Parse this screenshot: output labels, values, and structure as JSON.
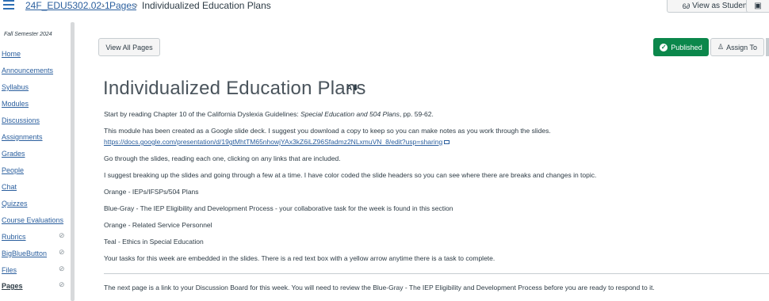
{
  "topbar": {
    "breadcrumbs": [
      "24F_EDU5302.02-1",
      "Pages",
      "Individualized Education Plans"
    ],
    "view_as_student": "View as Student",
    "view_icon": "glasses-icon"
  },
  "sidebar": {
    "term": "Fall Semester 2024",
    "items": [
      {
        "label": "Home",
        "hidden": false
      },
      {
        "label": "Announcements",
        "hidden": false
      },
      {
        "label": "Syllabus",
        "hidden": false
      },
      {
        "label": "Modules",
        "hidden": false
      },
      {
        "label": "Discussions",
        "hidden": false
      },
      {
        "label": "Assignments",
        "hidden": false
      },
      {
        "label": "Grades",
        "hidden": false
      },
      {
        "label": "People",
        "hidden": false
      },
      {
        "label": "Chat",
        "hidden": false
      },
      {
        "label": "Quizzes",
        "hidden": false
      },
      {
        "label": "Course Evaluations",
        "hidden": false
      },
      {
        "label": "Rubrics",
        "hidden": true
      },
      {
        "label": "BigBlueButton",
        "hidden": true
      },
      {
        "label": "Files",
        "hidden": true
      },
      {
        "label": "Pages",
        "hidden": true,
        "active": true
      }
    ]
  },
  "toolbar": {
    "view_all_pages": "View All Pages",
    "published": "Published",
    "assign_to": "Assign To"
  },
  "page": {
    "title": "Individualized Education Plans",
    "p1_pre": "Start by reading Chapter 10 of the California Dyslexia Guidelines: ",
    "p1_em": "Special Education and 504 Plans",
    "p1_post": ", pp. 59-62.",
    "p2": "This module has been created as a Google slide deck. I suggest you download a copy to keep so you can make notes as you work through the slides.",
    "link": "https://docs.google.com/presentation/d/19gtMhtTM65nhowjYAx3kZ6iLZ96Sfadmz2NLxmuVN_8/edit?usp=sharing",
    "p3": "Go through the slides, reading each one, clicking on any links that are included.",
    "p4": "I suggest breaking up the slides and going through a few at a time. I have color coded the slide headers so you can see where there are breaks and changes in topic.",
    "p5": "Orange - IEPs/IFSPs/504 Plans",
    "p6": "Blue-Gray - The IEP Eligibility and Development Process - your collaborative task for the week is found in this section",
    "p7": "Orange - Related Service Personnel",
    "p8": "Teal - Ethics in Special Education",
    "p9": "Your tasks for this week are embedded in the slides. There is a red text box with a yellow arrow anytime there is a task to complete.",
    "p10": "The next page is a link to your Discussion Board for this week. You will need to review the Blue-Gray - The IEP Eligibility and Development Process before you are ready to respond to it."
  },
  "colors": {
    "link": "#2b5f9e",
    "published_green": "#0b874b",
    "text": "#2d3b45"
  }
}
